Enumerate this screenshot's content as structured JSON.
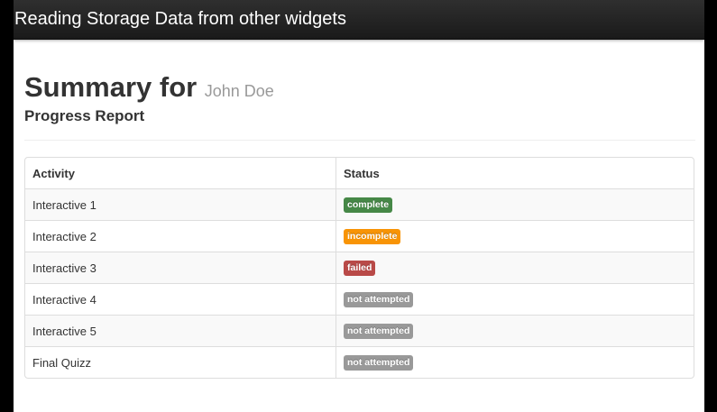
{
  "window": {
    "title": "Reading Storage Data from other widgets"
  },
  "header": {
    "summary_label": "Summary for",
    "user_name": "John Doe",
    "subtitle": "Progress Report"
  },
  "table": {
    "columns": [
      "Activity",
      "Status"
    ],
    "rows": [
      {
        "activity": "Interactive 1",
        "status": "complete",
        "status_color": "#468847"
      },
      {
        "activity": "Interactive 2",
        "status": "incomplete",
        "status_color": "#f89406"
      },
      {
        "activity": "Interactive 3",
        "status": "failed",
        "status_color": "#b94a48"
      },
      {
        "activity": "Interactive 4",
        "status": "not attempted",
        "status_color": "#999999"
      },
      {
        "activity": "Interactive 5",
        "status": "not attempted",
        "status_color": "#999999"
      },
      {
        "activity": "Final Quizz",
        "status": "not attempted",
        "status_color": "#999999"
      }
    ]
  }
}
